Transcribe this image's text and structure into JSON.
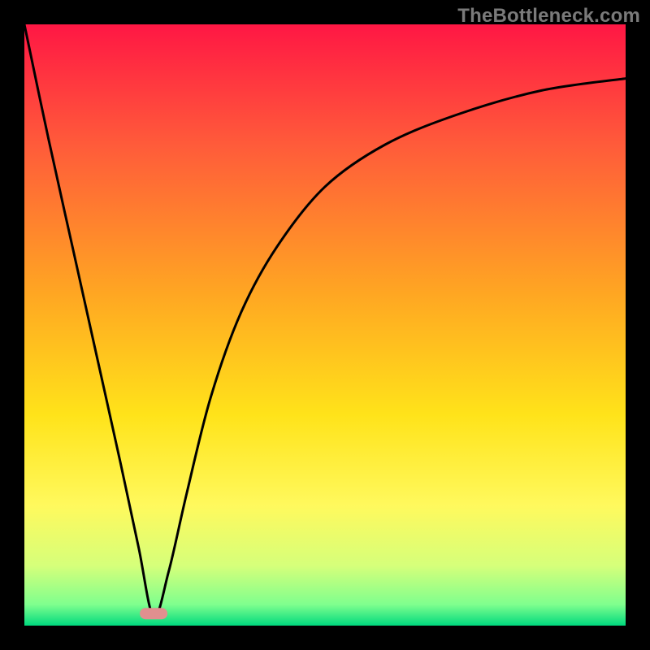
{
  "watermark": {
    "text": "TheBottleneck.com"
  },
  "chart_data": {
    "type": "line",
    "title": "",
    "xlabel": "",
    "ylabel": "",
    "xlim": [
      0,
      100
    ],
    "ylim": [
      0,
      100
    ],
    "grid": false,
    "legend": false,
    "background_gradient": {
      "stops": [
        {
          "offset": 0.0,
          "color": "#ff1744"
        },
        {
          "offset": 0.2,
          "color": "#ff5b3a"
        },
        {
          "offset": 0.45,
          "color": "#ffa722"
        },
        {
          "offset": 0.65,
          "color": "#ffe31a"
        },
        {
          "offset": 0.8,
          "color": "#fff95d"
        },
        {
          "offset": 0.9,
          "color": "#d6ff7a"
        },
        {
          "offset": 0.965,
          "color": "#7fff8e"
        },
        {
          "offset": 1.0,
          "color": "#00d97e"
        }
      ]
    },
    "marker": {
      "x": 21.5,
      "y": 2.0,
      "color": "#e18f8f"
    },
    "series": [
      {
        "name": "curve",
        "x": [
          0,
          4,
          8,
          12,
          16,
          19,
          21.5,
          24,
          27,
          31,
          36,
          42,
          50,
          60,
          72,
          86,
          100
        ],
        "y": [
          100,
          81,
          63,
          45,
          27,
          13,
          1.5,
          9,
          22,
          38,
          52,
          63,
          73,
          80,
          85,
          89,
          91
        ]
      }
    ]
  }
}
